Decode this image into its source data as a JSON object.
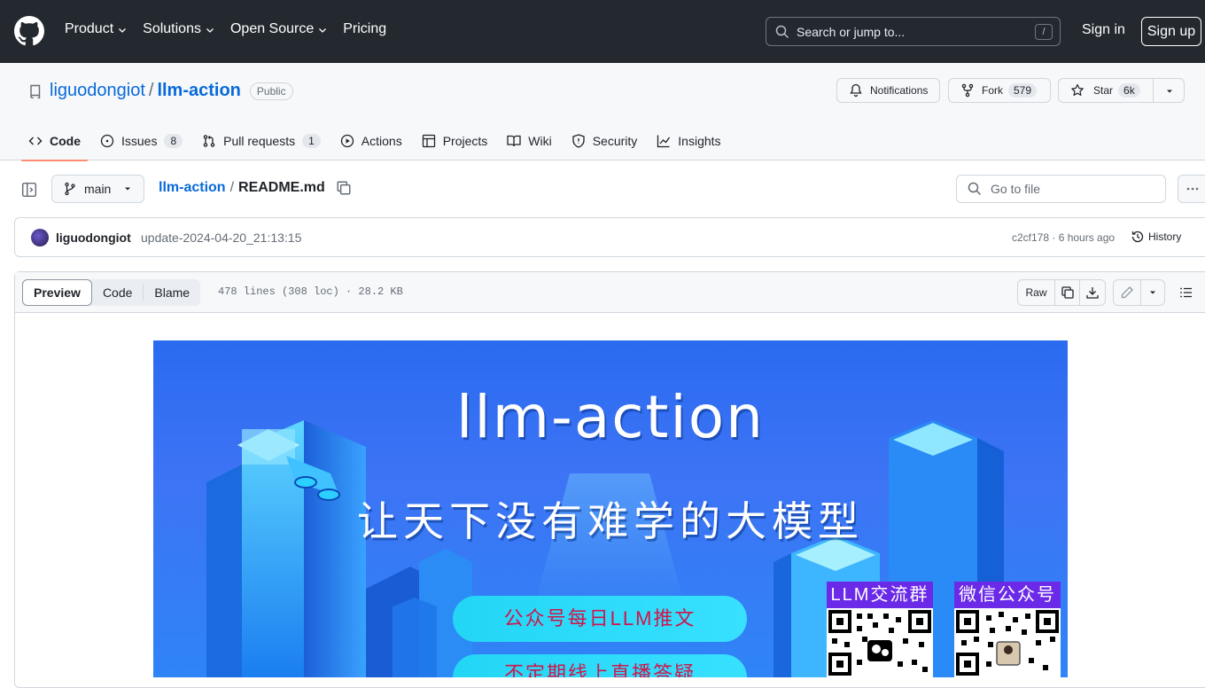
{
  "header": {
    "nav": [
      "Product",
      "Solutions",
      "Open Source",
      "Pricing"
    ],
    "search_placeholder": "Search or jump to...",
    "search_kbd": "/",
    "signin": "Sign in",
    "signup": "Sign up"
  },
  "repo": {
    "owner": "liguodongiot",
    "separator": "/",
    "name": "llm-action",
    "visibility": "Public",
    "notifications": "Notifications",
    "fork_label": "Fork",
    "fork_count": "579",
    "star_label": "Star",
    "star_count": "6k",
    "tabs": [
      {
        "label": "Code",
        "active": true
      },
      {
        "label": "Issues",
        "count": "8"
      },
      {
        "label": "Pull requests",
        "count": "1"
      },
      {
        "label": "Actions"
      },
      {
        "label": "Projects"
      },
      {
        "label": "Wiki"
      },
      {
        "label": "Security"
      },
      {
        "label": "Insights"
      }
    ]
  },
  "file": {
    "branch": "main",
    "crumb_repo": "llm-action",
    "crumb_sep": "/",
    "crumb_file": "README.md",
    "goto_placeholder": "Go to file",
    "commit_author": "liguodongiot",
    "commit_message": "update-2024-04-20_21:13:15",
    "commit_sha": "c2cf178 · 6 hours ago",
    "history": "History",
    "views": [
      "Preview",
      "Code",
      "Blame"
    ],
    "info": "478 lines (308 loc) · 28.2 KB",
    "raw": "Raw"
  },
  "banner": {
    "title": "llm-action",
    "subtitle": "让天下没有难学的大模型",
    "pill1": "公众号每日LLM推文",
    "pill2": "不定期线上直播答疑",
    "qr1_label": "LLM交流群",
    "qr2_label": "微信公众号"
  },
  "colors": {
    "header_bg": "#24292f",
    "link": "#0969da",
    "active_tab_underline": "#fd8c73",
    "banner_blue": "#2a6bf0"
  }
}
